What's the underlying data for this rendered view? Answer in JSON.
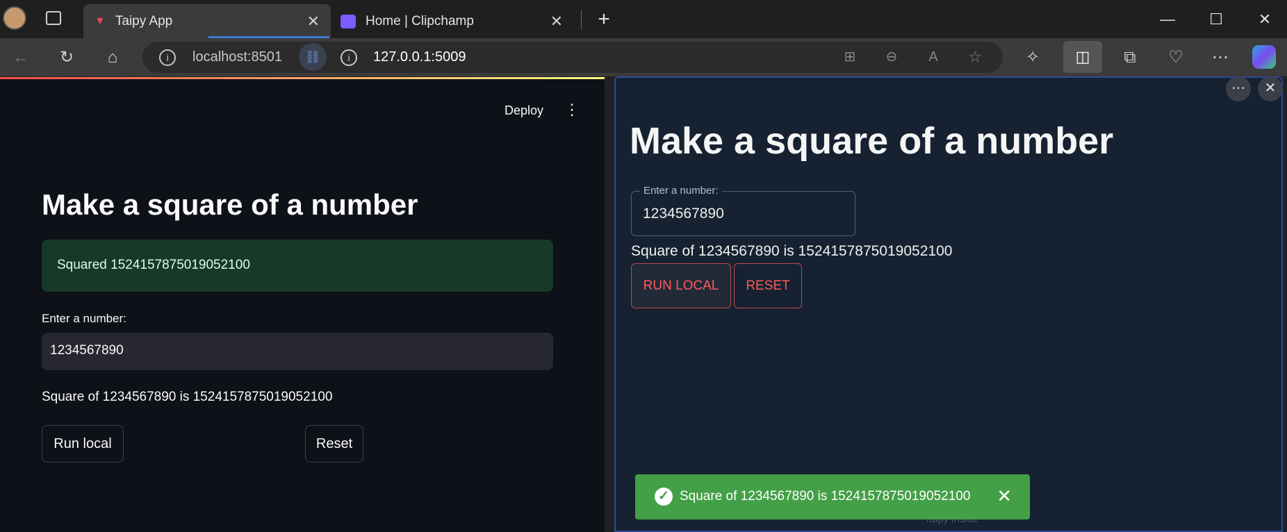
{
  "browser": {
    "tabs": [
      {
        "label": "Taipy App",
        "active": true
      },
      {
        "label": "Home | Clipchamp",
        "active": false
      }
    ],
    "address": {
      "left_url": "localhost:8501",
      "right_url": "127.0.0.1:5009"
    },
    "icons": [
      "back-icon",
      "refresh-icon",
      "home-icon",
      "info-icon",
      "link-icon",
      "apps-icon",
      "zoom-out-icon",
      "read-aloud-icon",
      "favorite-star-icon",
      "extensions-icon",
      "split-screen-icon",
      "collections-icon",
      "browser-essentials-icon",
      "more-icon",
      "copilot-icon"
    ]
  },
  "streamlit": {
    "deploy_label": "Deploy",
    "title": "Make a square of a number",
    "success_message": "Squared 1524157875019052100",
    "input_label": "Enter a number:",
    "input_value": "1234567890",
    "result_text": "Square of 1234567890 is 1524157875019052100",
    "run_button": "Run local",
    "reset_button": "Reset"
  },
  "taipy": {
    "title": "Make a square of a number",
    "input_label": "Enter a number:",
    "input_value": "1234567890",
    "result_text": "Square of 1234567890 is 1524157875019052100",
    "run_button": "RUN LOCAL",
    "reset_button": "RESET",
    "toast_message": "Square of 1234567890 is 1524157875019052100",
    "footer_text": "Taipy inside"
  },
  "colors": {
    "streamlit_bg": "#0e1117",
    "taipy_bg": "#162231",
    "toast_green": "#43a047",
    "taipy_accent": "#ff5b5b"
  }
}
